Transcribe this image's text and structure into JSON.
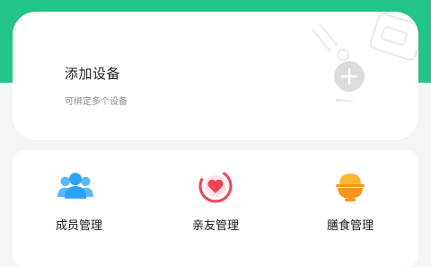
{
  "add_device": {
    "title": "添加设备",
    "subtitle": "可绑定多个设备"
  },
  "menu": {
    "items": [
      {
        "label": "成员管理",
        "icon": "members-icon",
        "color": "#2aa3f4"
      },
      {
        "label": "亲友管理",
        "icon": "heart-icon",
        "color": "#f0435a"
      },
      {
        "label": "膳食管理",
        "icon": "food-bowl-icon",
        "color": "#f7941d"
      }
    ]
  },
  "colors": {
    "brand_green": "#22c48a",
    "background": "#f4f6f5"
  }
}
